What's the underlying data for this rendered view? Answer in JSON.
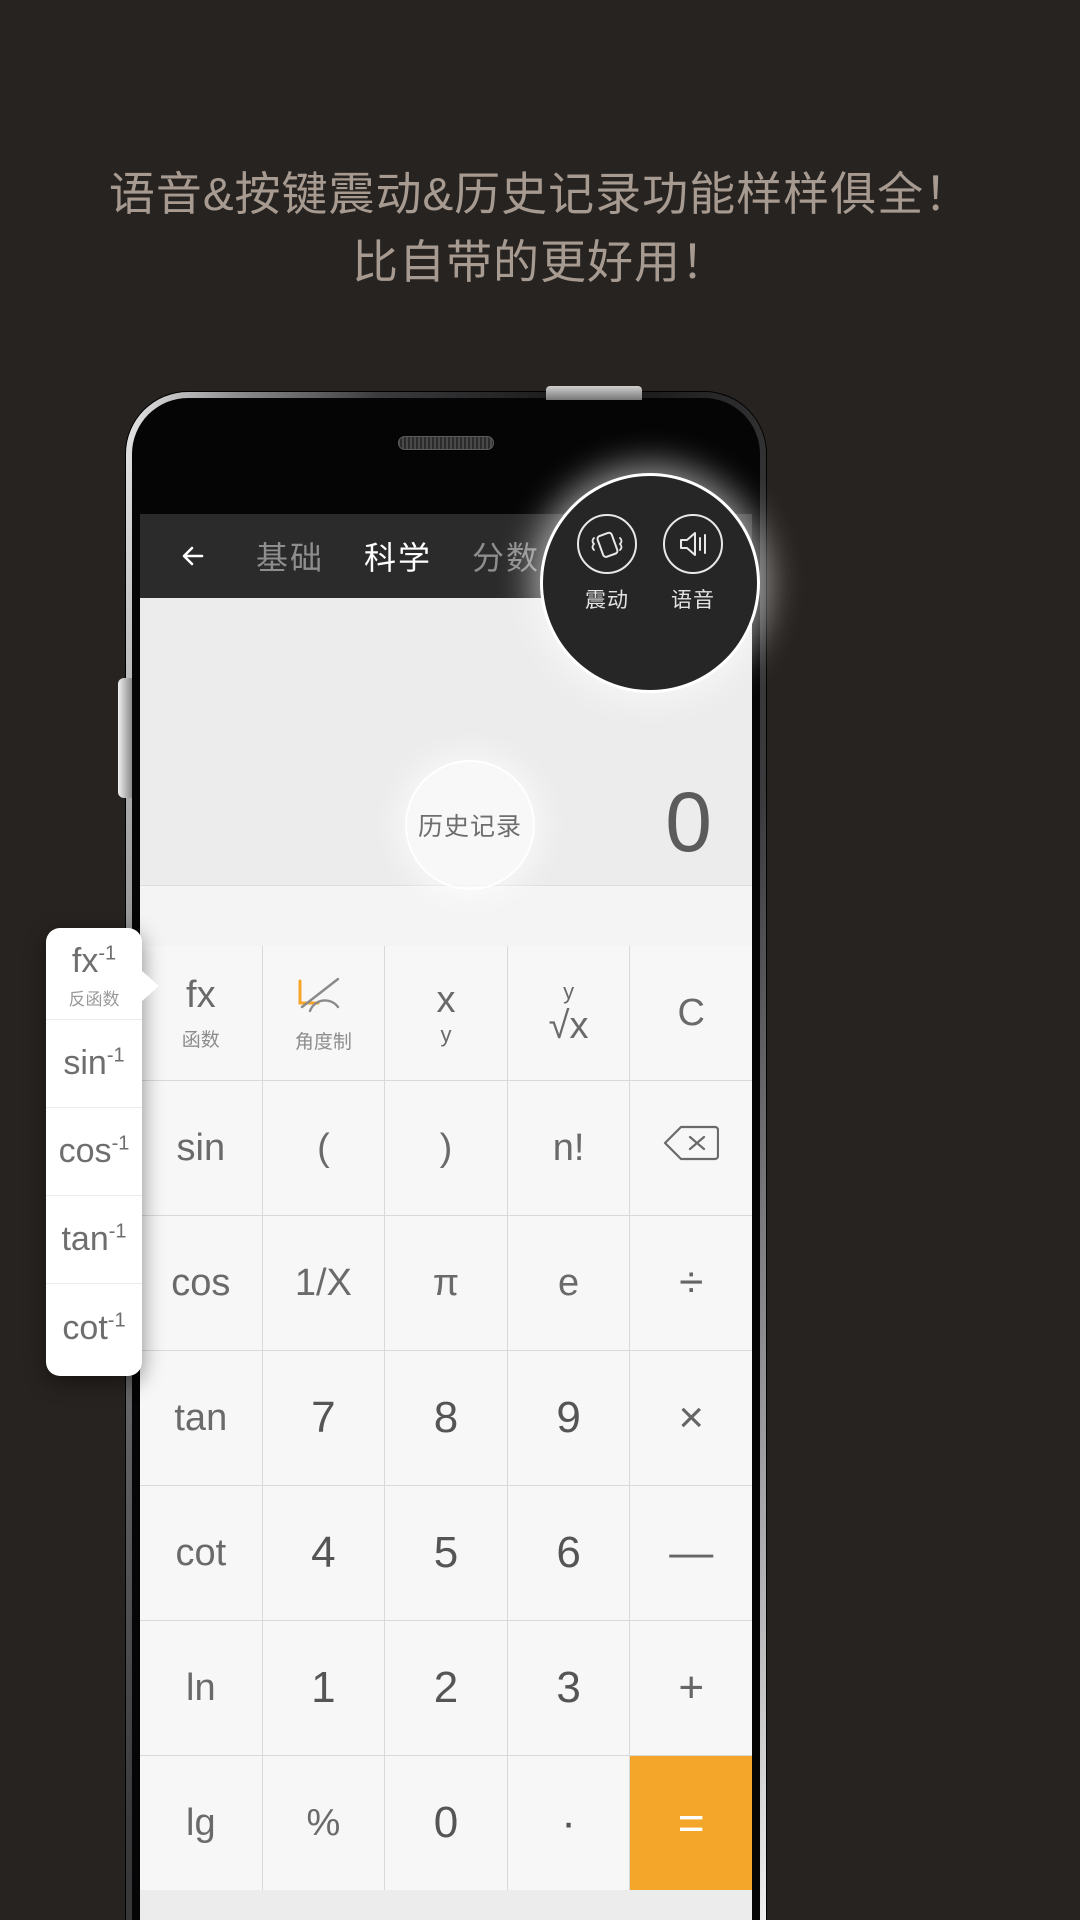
{
  "promo": {
    "line1": "语音&按键震动&历史记录功能样样俱全！",
    "line2": "比自带的更好用！"
  },
  "colors": {
    "background": "#272320",
    "promo_text": "#a79b91",
    "navbar": "#2b2b2b",
    "display_bg": "#ececec",
    "key_bg": "#f7f7f7",
    "accent_orange": "#f4a62a",
    "key_text": "#6a6a6a"
  },
  "app": {
    "navbar": {
      "back_icon": "back-arrow-icon",
      "tabs": [
        {
          "label": "基础",
          "active": false
        },
        {
          "label": "科学",
          "active": true
        },
        {
          "label": "分数",
          "active": false
        }
      ]
    },
    "features": [
      {
        "icon": "vibrate-icon",
        "label": "震动"
      },
      {
        "icon": "speaker-icon",
        "label": "语音"
      }
    ],
    "display": {
      "value": "0"
    },
    "history_hint": "历史记录",
    "keypad": [
      {
        "label": "fx",
        "sub": "函数",
        "type": "func"
      },
      {
        "label": "∠",
        "sub": "角度制",
        "type": "angle"
      },
      {
        "label": "x",
        "sup": "y",
        "type": "func"
      },
      {
        "label": "√x",
        "sup": "y",
        "type": "root"
      },
      {
        "label": "C",
        "type": "func"
      },
      {
        "label": "sin",
        "type": "func"
      },
      {
        "label": "(",
        "type": "func"
      },
      {
        "label": ")",
        "type": "func"
      },
      {
        "label": "n!",
        "type": "func"
      },
      {
        "label": "⌫",
        "type": "backspace"
      },
      {
        "label": "cos",
        "type": "func"
      },
      {
        "label": "1/X",
        "type": "func"
      },
      {
        "label": "π",
        "type": "func"
      },
      {
        "label": "e",
        "type": "func"
      },
      {
        "label": "÷",
        "type": "op"
      },
      {
        "label": "tan",
        "type": "func"
      },
      {
        "label": "7",
        "type": "digit"
      },
      {
        "label": "8",
        "type": "digit"
      },
      {
        "label": "9",
        "type": "digit"
      },
      {
        "label": "×",
        "type": "op"
      },
      {
        "label": "cot",
        "type": "func"
      },
      {
        "label": "4",
        "type": "digit"
      },
      {
        "label": "5",
        "type": "digit"
      },
      {
        "label": "6",
        "type": "digit"
      },
      {
        "label": "—",
        "type": "op"
      },
      {
        "label": "ln",
        "type": "func"
      },
      {
        "label": "1",
        "type": "digit"
      },
      {
        "label": "2",
        "type": "digit"
      },
      {
        "label": "3",
        "type": "digit"
      },
      {
        "label": "+",
        "type": "op"
      },
      {
        "label": "lg",
        "type": "func"
      },
      {
        "label": "%",
        "type": "func"
      },
      {
        "label": "0",
        "type": "digit"
      },
      {
        "label": "·",
        "type": "digit"
      },
      {
        "label": "=",
        "type": "equals"
      }
    ],
    "inverse_popup": [
      {
        "label": "fx",
        "sup": "-1",
        "sub": "反函数"
      },
      {
        "label": "sin",
        "sup": "-1",
        "sub": ""
      },
      {
        "label": "cos",
        "sup": "-1",
        "sub": ""
      },
      {
        "label": "tan",
        "sup": "-1",
        "sub": ""
      },
      {
        "label": "cot",
        "sup": "-1",
        "sub": ""
      }
    ]
  }
}
